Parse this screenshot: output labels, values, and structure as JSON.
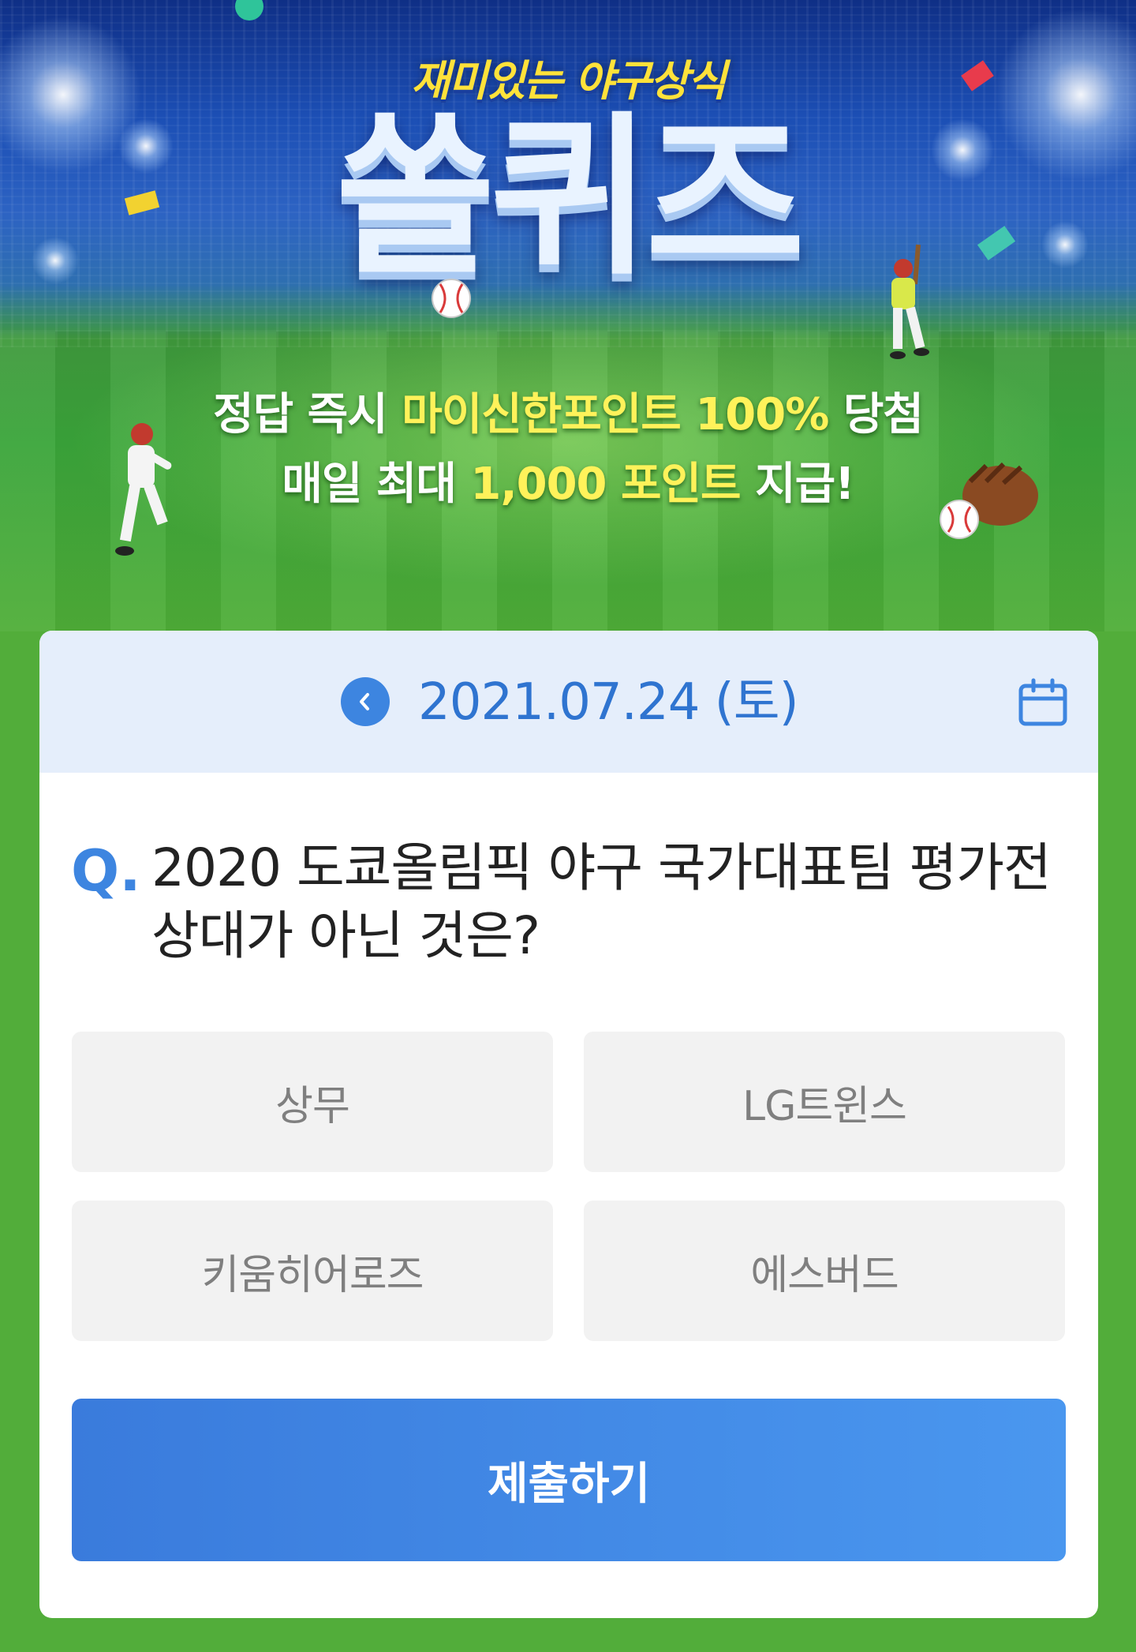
{
  "banner": {
    "subtitle": "재미있는 야구상식",
    "title": "쏠퀴즈",
    "line1_pre": "정답 즉시 ",
    "line1_highlight": "마이신한포인트 100%",
    "line1_post": " 당첨",
    "line2_pre": "매일 최대 ",
    "line2_highlight": "1,000 포인트",
    "line2_post": " 지급!"
  },
  "date_bar": {
    "date": "2021.07.24 (토)",
    "prev_icon": "chevron-left-icon",
    "calendar_icon": "calendar-icon"
  },
  "question": {
    "marker": "Q.",
    "text": "2020 도쿄올림픽 야구 국가대표팀 평가전 상대가 아닌 것은?"
  },
  "options": [
    "상무",
    "LG트윈스",
    "키움히어로즈",
    "에스버드"
  ],
  "submit_label": "제출하기",
  "colors": {
    "accent": "#3d85e0",
    "date_bar_bg": "#e5eefb",
    "option_bg": "#f2f2f2",
    "page_bg": "#52ad3a",
    "highlight": "#fff25a"
  }
}
